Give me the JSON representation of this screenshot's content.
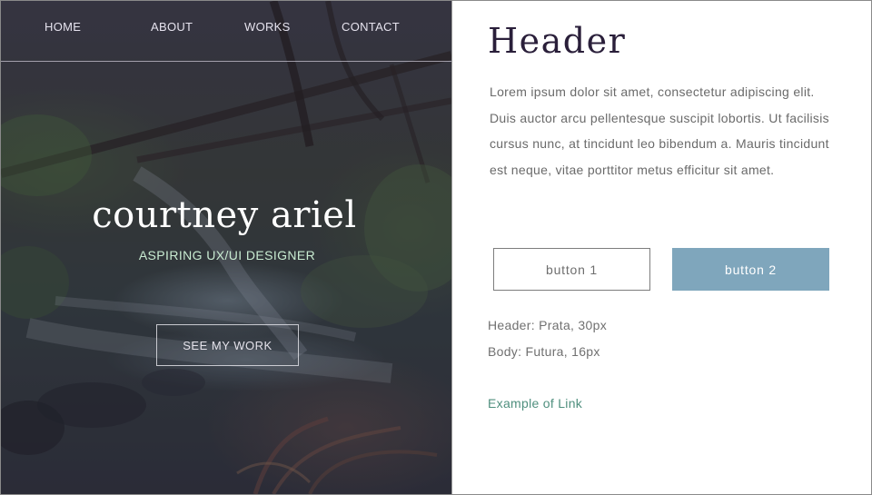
{
  "nav": {
    "items": [
      {
        "label": "HOME"
      },
      {
        "label": "ABOUT"
      },
      {
        "label": "WORKS"
      },
      {
        "label": "CONTACT"
      }
    ]
  },
  "hero": {
    "name": "courtney ariel",
    "subtitle": "ASPIRING UX/UI DESIGNER",
    "cta_label": "SEE MY WORK",
    "background": "forest-waterfall-photo"
  },
  "panel": {
    "header": "Header",
    "body": "Lorem ipsum dolor sit amet, consectetur adipiscing elit. Duis auctor arcu pellentesque suscipit lobortis. Ut facilisis cursus nunc, at tincidunt leo bibendum a. Mauris tincidunt est neque, vitae porttitor metus efficitur sit amet.",
    "button1_label": "button 1",
    "button2_label": "button 2",
    "spec_header": "Header: Prata, 30px",
    "spec_body": "Body: Futura, 16px",
    "link_label": "Example of Link"
  },
  "colors": {
    "header_text": "#2a1f3a",
    "button2_bg": "#7fa6bc",
    "link": "#4f8f7e",
    "hero_subtitle": "#c9ecd2"
  }
}
